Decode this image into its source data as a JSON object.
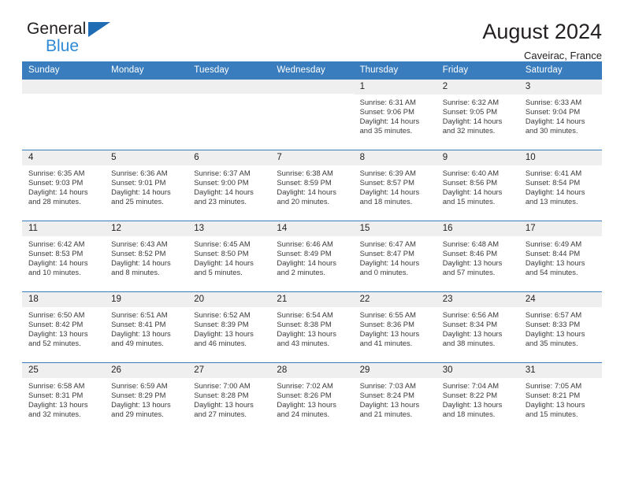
{
  "logo": {
    "line1": "General",
    "line2": "Blue",
    "triangle_icon": "blue-triangle-icon",
    "accent": "#2e8ad6"
  },
  "header": {
    "title": "August 2024",
    "subtitle": "Caveirac, France"
  },
  "theme": {
    "header_blue": "#3a7dbe",
    "daynum_gray": "#efefef",
    "text": "#231f20"
  },
  "weekdays": [
    "Sunday",
    "Monday",
    "Tuesday",
    "Wednesday",
    "Thursday",
    "Friday",
    "Saturday"
  ],
  "labels": {
    "sunrise": "Sunrise:",
    "sunset": "Sunset:",
    "daylight": "Daylight:"
  },
  "weeks": [
    [
      {
        "day": ""
      },
      {
        "day": ""
      },
      {
        "day": ""
      },
      {
        "day": ""
      },
      {
        "day": "1",
        "sunrise": "Sunrise: 6:31 AM",
        "sunset": "Sunset: 9:06 PM",
        "daylight": "Daylight: 14 hours and 35 minutes."
      },
      {
        "day": "2",
        "sunrise": "Sunrise: 6:32 AM",
        "sunset": "Sunset: 9:05 PM",
        "daylight": "Daylight: 14 hours and 32 minutes."
      },
      {
        "day": "3",
        "sunrise": "Sunrise: 6:33 AM",
        "sunset": "Sunset: 9:04 PM",
        "daylight": "Daylight: 14 hours and 30 minutes."
      }
    ],
    [
      {
        "day": "4",
        "sunrise": "Sunrise: 6:35 AM",
        "sunset": "Sunset: 9:03 PM",
        "daylight": "Daylight: 14 hours and 28 minutes."
      },
      {
        "day": "5",
        "sunrise": "Sunrise: 6:36 AM",
        "sunset": "Sunset: 9:01 PM",
        "daylight": "Daylight: 14 hours and 25 minutes."
      },
      {
        "day": "6",
        "sunrise": "Sunrise: 6:37 AM",
        "sunset": "Sunset: 9:00 PM",
        "daylight": "Daylight: 14 hours and 23 minutes."
      },
      {
        "day": "7",
        "sunrise": "Sunrise: 6:38 AM",
        "sunset": "Sunset: 8:59 PM",
        "daylight": "Daylight: 14 hours and 20 minutes."
      },
      {
        "day": "8",
        "sunrise": "Sunrise: 6:39 AM",
        "sunset": "Sunset: 8:57 PM",
        "daylight": "Daylight: 14 hours and 18 minutes."
      },
      {
        "day": "9",
        "sunrise": "Sunrise: 6:40 AM",
        "sunset": "Sunset: 8:56 PM",
        "daylight": "Daylight: 14 hours and 15 minutes."
      },
      {
        "day": "10",
        "sunrise": "Sunrise: 6:41 AM",
        "sunset": "Sunset: 8:54 PM",
        "daylight": "Daylight: 14 hours and 13 minutes."
      }
    ],
    [
      {
        "day": "11",
        "sunrise": "Sunrise: 6:42 AM",
        "sunset": "Sunset: 8:53 PM",
        "daylight": "Daylight: 14 hours and 10 minutes."
      },
      {
        "day": "12",
        "sunrise": "Sunrise: 6:43 AM",
        "sunset": "Sunset: 8:52 PM",
        "daylight": "Daylight: 14 hours and 8 minutes."
      },
      {
        "day": "13",
        "sunrise": "Sunrise: 6:45 AM",
        "sunset": "Sunset: 8:50 PM",
        "daylight": "Daylight: 14 hours and 5 minutes."
      },
      {
        "day": "14",
        "sunrise": "Sunrise: 6:46 AM",
        "sunset": "Sunset: 8:49 PM",
        "daylight": "Daylight: 14 hours and 2 minutes."
      },
      {
        "day": "15",
        "sunrise": "Sunrise: 6:47 AM",
        "sunset": "Sunset: 8:47 PM",
        "daylight": "Daylight: 14 hours and 0 minutes."
      },
      {
        "day": "16",
        "sunrise": "Sunrise: 6:48 AM",
        "sunset": "Sunset: 8:46 PM",
        "daylight": "Daylight: 13 hours and 57 minutes."
      },
      {
        "day": "17",
        "sunrise": "Sunrise: 6:49 AM",
        "sunset": "Sunset: 8:44 PM",
        "daylight": "Daylight: 13 hours and 54 minutes."
      }
    ],
    [
      {
        "day": "18",
        "sunrise": "Sunrise: 6:50 AM",
        "sunset": "Sunset: 8:42 PM",
        "daylight": "Daylight: 13 hours and 52 minutes."
      },
      {
        "day": "19",
        "sunrise": "Sunrise: 6:51 AM",
        "sunset": "Sunset: 8:41 PM",
        "daylight": "Daylight: 13 hours and 49 minutes."
      },
      {
        "day": "20",
        "sunrise": "Sunrise: 6:52 AM",
        "sunset": "Sunset: 8:39 PM",
        "daylight": "Daylight: 13 hours and 46 minutes."
      },
      {
        "day": "21",
        "sunrise": "Sunrise: 6:54 AM",
        "sunset": "Sunset: 8:38 PM",
        "daylight": "Daylight: 13 hours and 43 minutes."
      },
      {
        "day": "22",
        "sunrise": "Sunrise: 6:55 AM",
        "sunset": "Sunset: 8:36 PM",
        "daylight": "Daylight: 13 hours and 41 minutes."
      },
      {
        "day": "23",
        "sunrise": "Sunrise: 6:56 AM",
        "sunset": "Sunset: 8:34 PM",
        "daylight": "Daylight: 13 hours and 38 minutes."
      },
      {
        "day": "24",
        "sunrise": "Sunrise: 6:57 AM",
        "sunset": "Sunset: 8:33 PM",
        "daylight": "Daylight: 13 hours and 35 minutes."
      }
    ],
    [
      {
        "day": "25",
        "sunrise": "Sunrise: 6:58 AM",
        "sunset": "Sunset: 8:31 PM",
        "daylight": "Daylight: 13 hours and 32 minutes."
      },
      {
        "day": "26",
        "sunrise": "Sunrise: 6:59 AM",
        "sunset": "Sunset: 8:29 PM",
        "daylight": "Daylight: 13 hours and 29 minutes."
      },
      {
        "day": "27",
        "sunrise": "Sunrise: 7:00 AM",
        "sunset": "Sunset: 8:28 PM",
        "daylight": "Daylight: 13 hours and 27 minutes."
      },
      {
        "day": "28",
        "sunrise": "Sunrise: 7:02 AM",
        "sunset": "Sunset: 8:26 PM",
        "daylight": "Daylight: 13 hours and 24 minutes."
      },
      {
        "day": "29",
        "sunrise": "Sunrise: 7:03 AM",
        "sunset": "Sunset: 8:24 PM",
        "daylight": "Daylight: 13 hours and 21 minutes."
      },
      {
        "day": "30",
        "sunrise": "Sunrise: 7:04 AM",
        "sunset": "Sunset: 8:22 PM",
        "daylight": "Daylight: 13 hours and 18 minutes."
      },
      {
        "day": "31",
        "sunrise": "Sunrise: 7:05 AM",
        "sunset": "Sunset: 8:21 PM",
        "daylight": "Daylight: 13 hours and 15 minutes."
      }
    ]
  ]
}
